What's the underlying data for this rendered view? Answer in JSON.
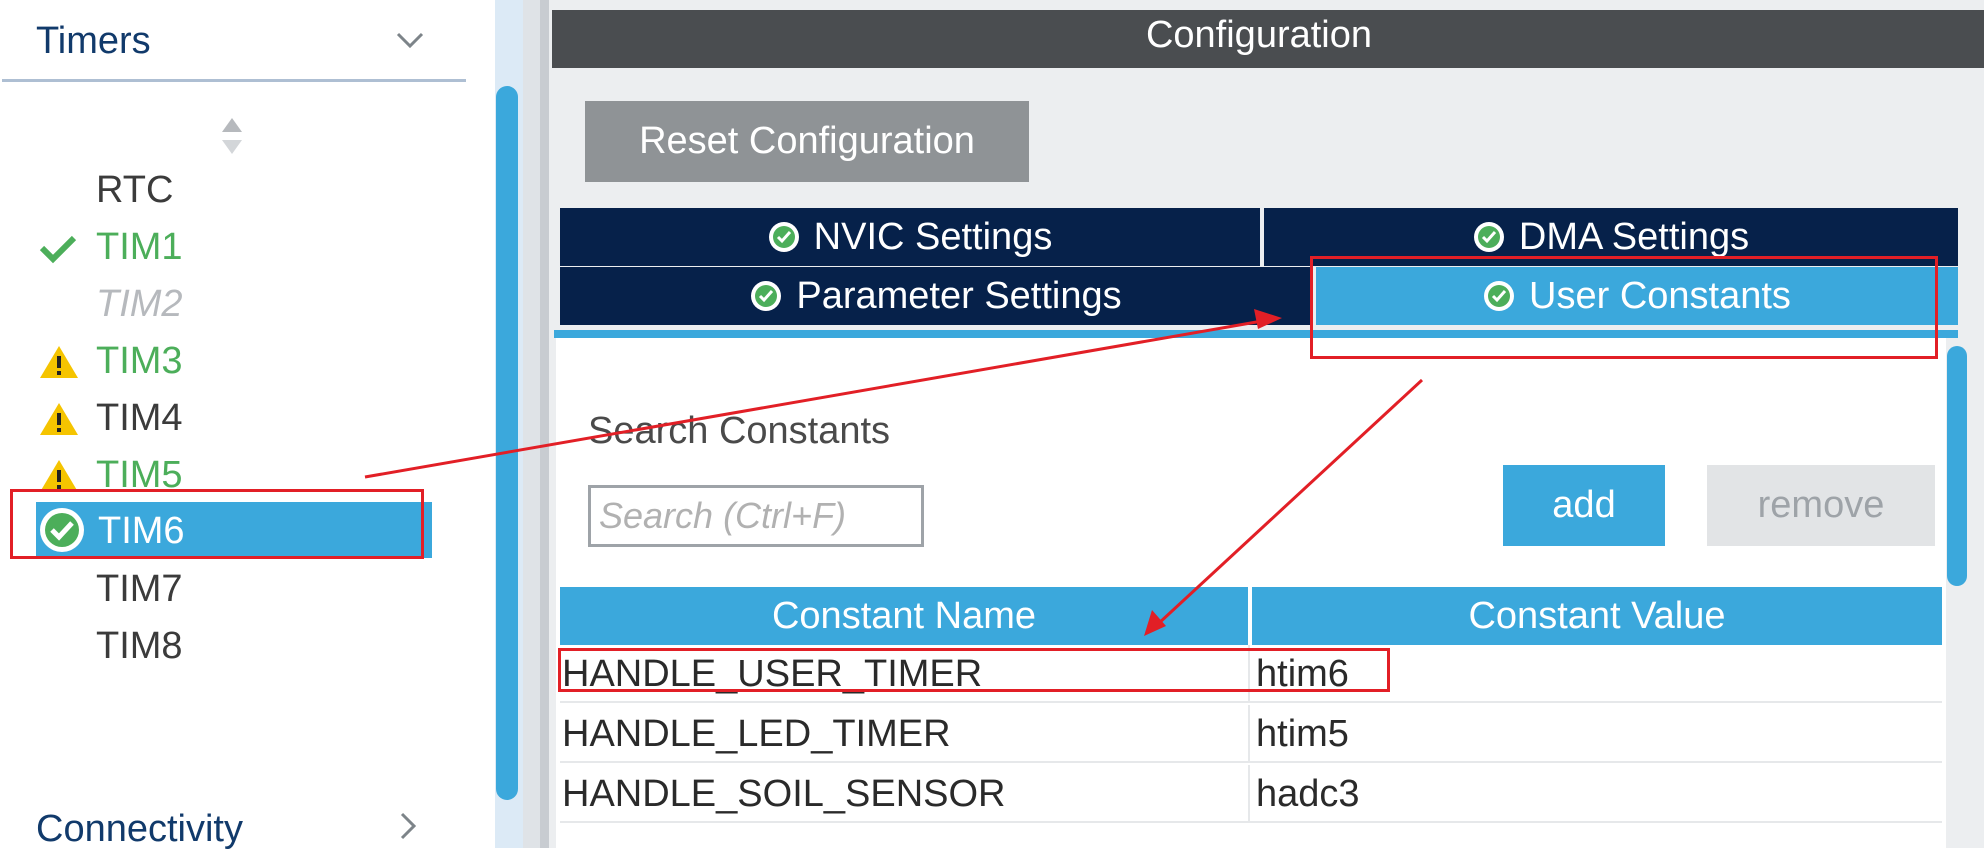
{
  "sidebar": {
    "category": "Timers",
    "items": [
      {
        "label": "RTC",
        "style": "normal",
        "icon": ""
      },
      {
        "label": "TIM1",
        "style": "green",
        "icon": "checkmark-icon"
      },
      {
        "label": "TIM2",
        "style": "disabled",
        "icon": ""
      },
      {
        "label": "TIM3",
        "style": "green",
        "icon": "warning-icon"
      },
      {
        "label": "TIM4",
        "style": "normal",
        "icon": "warning-icon"
      },
      {
        "label": "TIM5",
        "style": "green",
        "icon": "warning-icon"
      },
      {
        "label": "TIM6",
        "style": "selected",
        "icon": "circle-check-icon"
      },
      {
        "label": "TIM7",
        "style": "normal",
        "icon": ""
      },
      {
        "label": "TIM8",
        "style": "normal",
        "icon": ""
      }
    ],
    "next_category": "Connectivity"
  },
  "config": {
    "title": "Configuration",
    "reset_label": "Reset Configuration",
    "tabs": [
      {
        "label": "NVIC Settings",
        "active": false
      },
      {
        "label": "DMA Settings",
        "active": false
      },
      {
        "label": "Parameter Settings",
        "active": false
      },
      {
        "label": "User Constants",
        "active": true
      }
    ],
    "search_label": "Search Constants",
    "search_placeholder": "Search (Ctrl+F)",
    "add_label": "add",
    "remove_label": "remove",
    "table": {
      "headers": [
        "Constant Name",
        "Constant Value"
      ],
      "rows": [
        [
          "HANDLE_USER_TIMER",
          "htim6"
        ],
        [
          "HANDLE_LED_TIMER",
          "htim5"
        ],
        [
          "HANDLE_SOIL_SENSOR",
          "hadc3"
        ]
      ]
    }
  },
  "colors": {
    "accent_blue": "#3ba8dc",
    "tab_navy": "#06214a",
    "title_bar": "#4a4d50",
    "annotation_red": "#e21f26",
    "status_green": "#4cae5a",
    "warning_yellow": "#f5c400"
  }
}
